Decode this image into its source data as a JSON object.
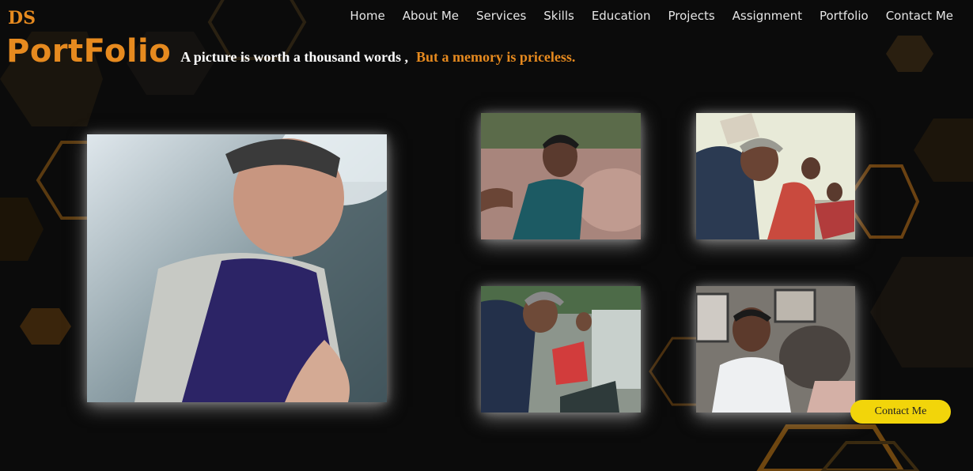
{
  "header": {
    "logo_initials": "DS",
    "title": "PortFolio",
    "tagline_main": "A picture is worth a thousand words ,",
    "tagline_accent": "But a memory is priceless."
  },
  "nav": {
    "items": [
      "Home",
      "About Me",
      "Services",
      "Skills",
      "Education",
      "Projects",
      "Assignment",
      "Portfolio",
      "Contact Me"
    ]
  },
  "contact_button": {
    "label": "Contact Me"
  },
  "colors": {
    "accent": "#e68a1f",
    "background": "#0b0b0b",
    "button": "#f2d50a"
  }
}
